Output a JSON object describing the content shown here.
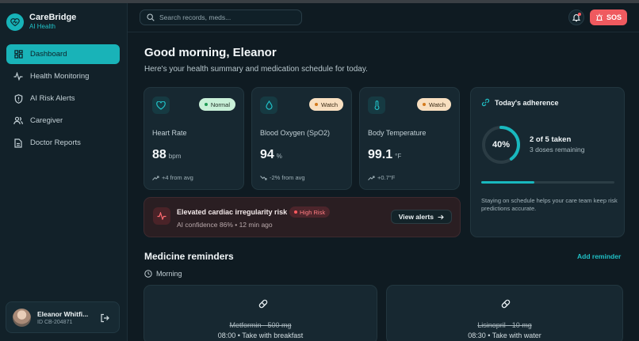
{
  "brand": {
    "name": "CareBridge",
    "subtitle": "AI Health"
  },
  "sidebar": {
    "items": [
      {
        "label": "Dashboard",
        "icon": "grid-icon",
        "active": true
      },
      {
        "label": "Health Monitoring",
        "icon": "pulse-icon"
      },
      {
        "label": "AI Risk Alerts",
        "icon": "shield-icon"
      },
      {
        "label": "Caregiver",
        "icon": "users-icon"
      },
      {
        "label": "Doctor Reports",
        "icon": "document-icon"
      }
    ]
  },
  "user": {
    "name": "Eleanor Whitfi...",
    "id": "ID CB-204871"
  },
  "search": {
    "placeholder": "Search records, meds..."
  },
  "topbar": {
    "sos_label": "SOS"
  },
  "greeting": {
    "title": "Good morning, Eleanor",
    "subtitle": "Here's your health summary and medication schedule for today."
  },
  "vitals": [
    {
      "name": "Heart Rate",
      "value": "88",
      "unit": "bpm",
      "status": "Normal",
      "trend": "+4 from avg",
      "icon": "heart-icon"
    },
    {
      "name": "Blood Oxygen (SpO2)",
      "value": "94",
      "unit": "%",
      "status": "Watch",
      "trend": "-2% from avg",
      "icon": "droplet-icon"
    },
    {
      "name": "Body Temperature",
      "value": "99.1",
      "unit": "°F",
      "status": "Watch",
      "trend": "+0.7°F",
      "icon": "thermometer-icon"
    }
  ],
  "alert": {
    "title": "Elevated cardiac irregularity risk",
    "badge": "High Risk",
    "subtitle": "AI confidence 86% • 12 min ago",
    "button": "View alerts"
  },
  "adherence": {
    "title": "Today's adherence",
    "percent_label": "40%",
    "percent": 40,
    "taken": "2 of 5 taken",
    "remaining": "3 doses remaining",
    "note": "Staying on schedule helps your care team keep risk predictions accurate."
  },
  "reminders": {
    "title": "Medicine reminders",
    "add_label": "Add reminder",
    "period": "Morning",
    "items": [
      {
        "name": "Metformin · 500 mg",
        "time": "08:00 • Take with breakfast"
      },
      {
        "name": "Lisinopril · 10 mg",
        "time": "08:30 • Take with water"
      }
    ]
  },
  "colors": {
    "accent": "#19b3b8",
    "danger": "#ef5a5f",
    "background": "#0f1b22"
  }
}
